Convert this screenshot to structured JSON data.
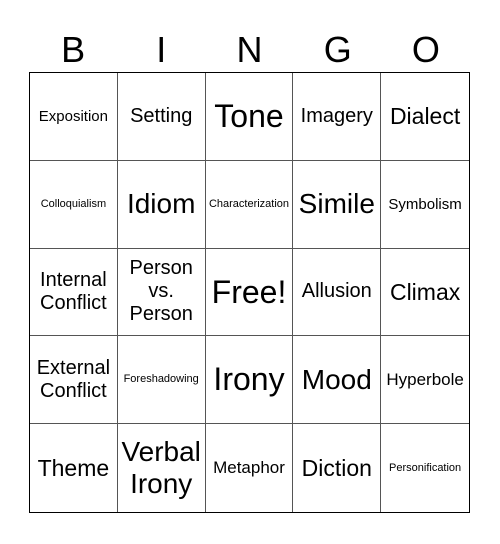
{
  "header": [
    "B",
    "I",
    "N",
    "G",
    "O"
  ],
  "cells": [
    "Exposition",
    "Setting",
    "Tone",
    "Imagery",
    "Dialect",
    "Colloquialism",
    "Idiom",
    "Characterization",
    "Simile",
    "Symbolism",
    "Internal Conflict",
    "Person vs. Person",
    "Free!",
    "Allusion",
    "Climax",
    "External Conflict",
    "Foreshadowing",
    "Irony",
    "Mood",
    "Hyperbole",
    "Theme",
    "Verbal Irony",
    "Metaphor",
    "Diction",
    "Personification"
  ]
}
